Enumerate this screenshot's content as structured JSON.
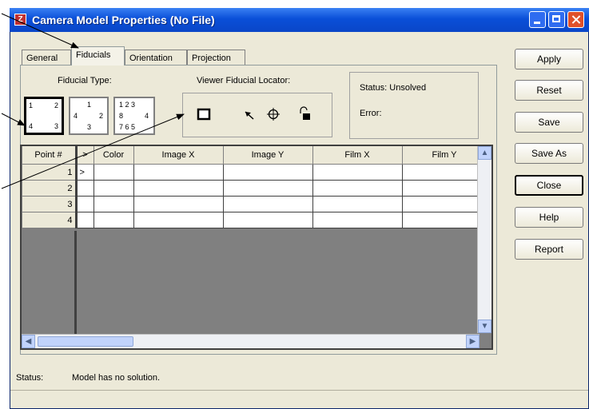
{
  "window": {
    "title": "Camera Model Properties (No File)"
  },
  "tabs": [
    "General",
    "Fiducials",
    "Orientation",
    "Projection"
  ],
  "fiducial_type": {
    "label": "Fiducial Type:",
    "layout1": [
      "1",
      "2",
      "4",
      "3"
    ],
    "layout2": [
      "1",
      "4",
      "2",
      "3"
    ],
    "layout3": [
      "1 2 3",
      "8",
      "4",
      "7 6 5"
    ]
  },
  "locator": {
    "label": "Viewer Fiducial Locator:"
  },
  "status_box": {
    "status": "Status: Unsolved",
    "error": "Error:"
  },
  "grid": {
    "headers": [
      "Point #",
      ">",
      "Color",
      "Image X",
      "Image Y",
      "Film X",
      "Film Y"
    ],
    "rows": [
      "1",
      "2",
      "3",
      "4"
    ],
    "row_marker": ">"
  },
  "buttons": [
    "Apply",
    "Reset",
    "Save",
    "Save As",
    "Close",
    "Help",
    "Report"
  ],
  "statusbar": {
    "label": "Status:",
    "value": "Model has no solution."
  }
}
